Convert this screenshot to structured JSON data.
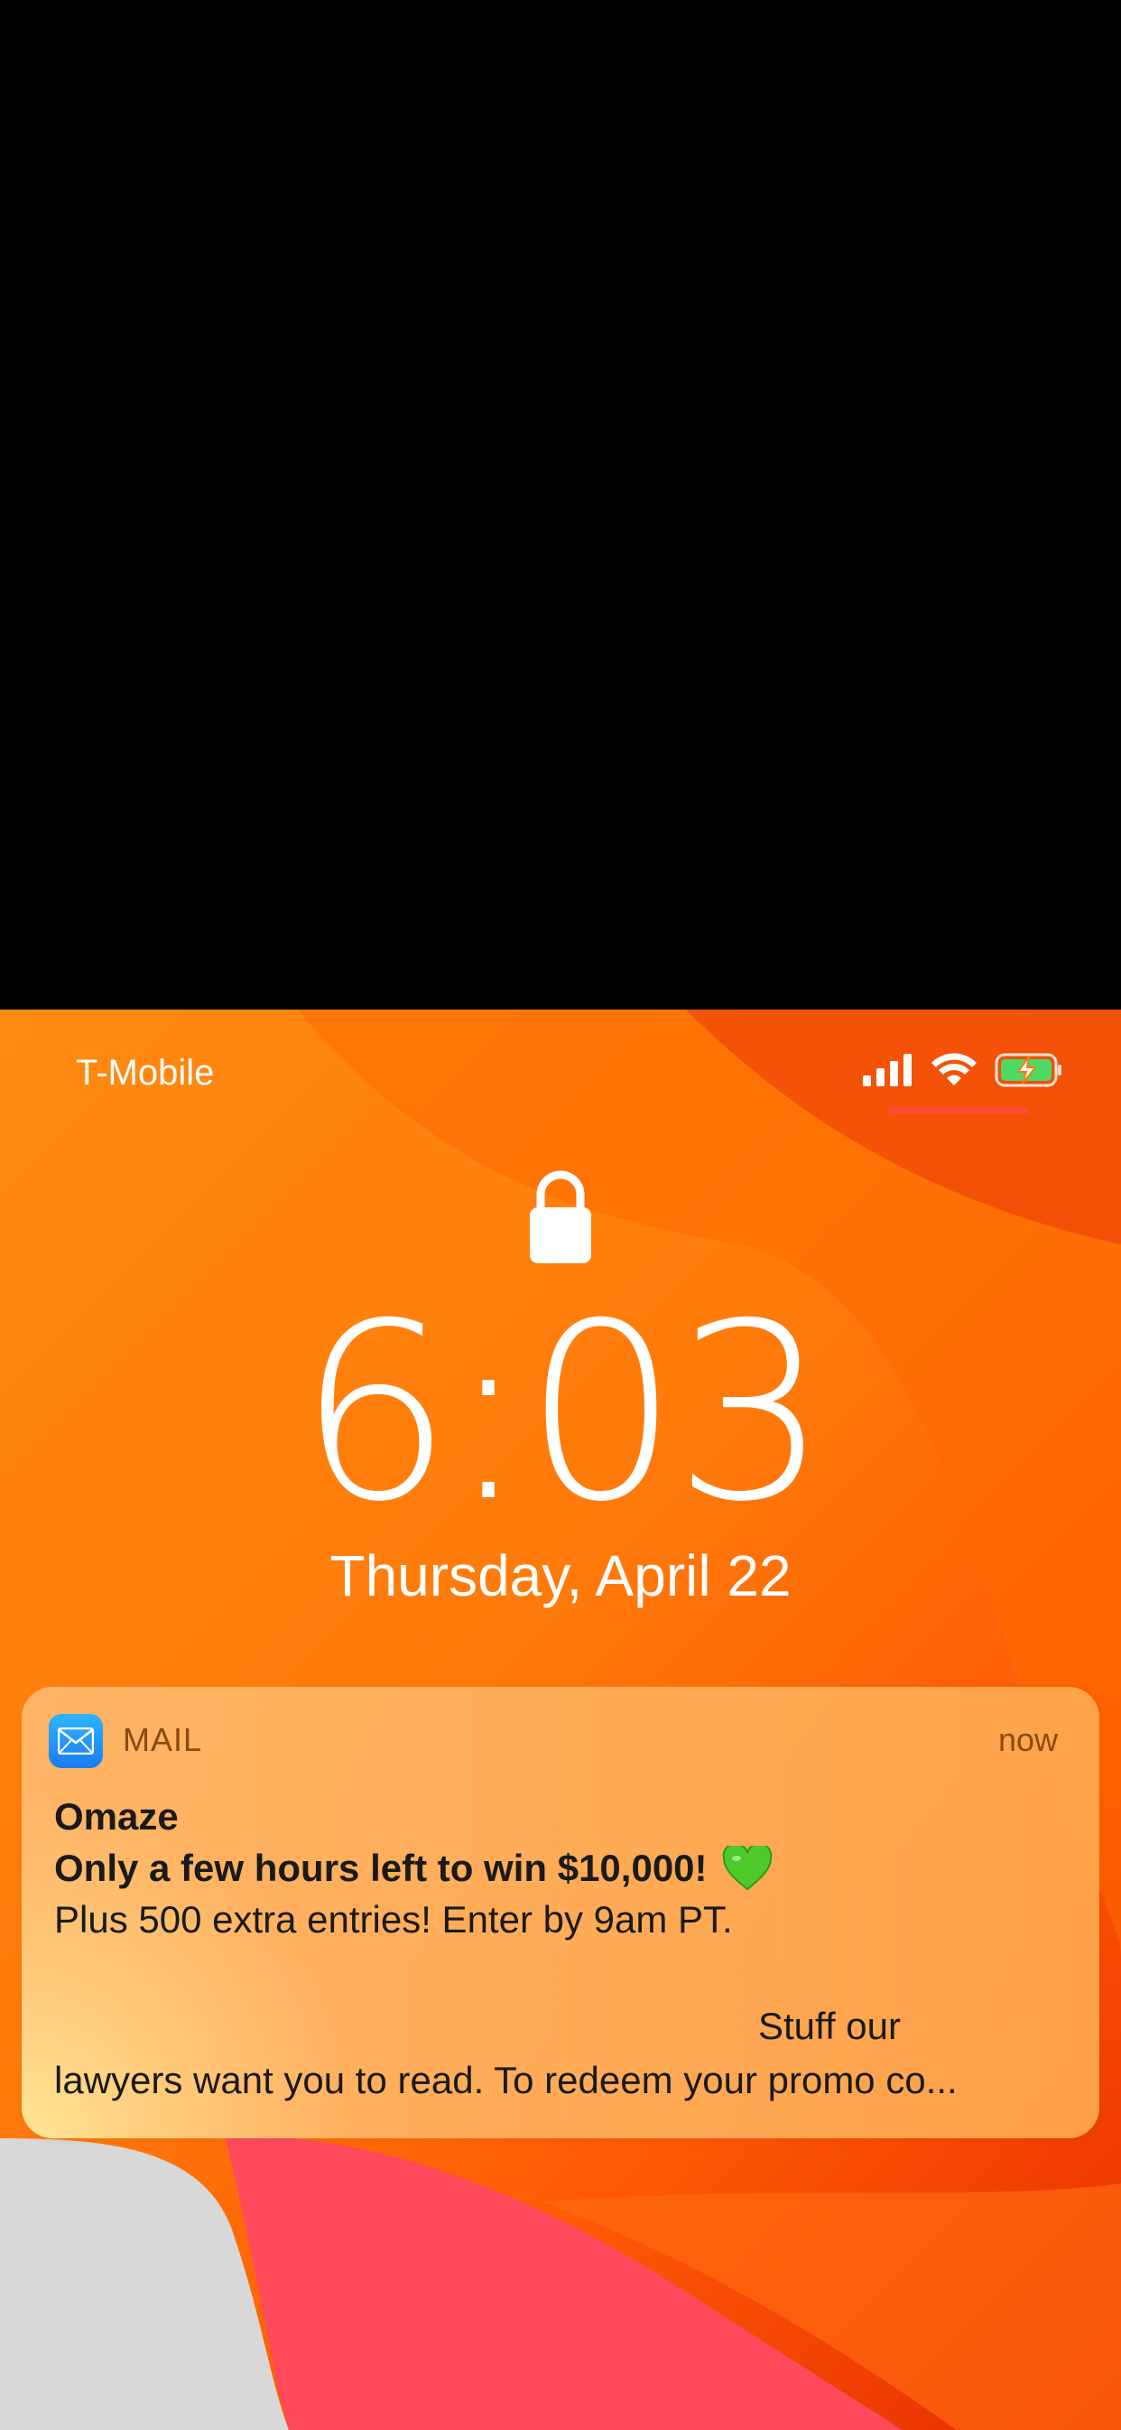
{
  "status_bar": {
    "carrier": "T-Mobile",
    "icons": [
      "cellular-signal-icon",
      "wifi-icon",
      "battery-charging-icon"
    ],
    "battery_color": "#4cd964"
  },
  "lockscreen": {
    "lock_icon": "lock-icon",
    "time": "6:03",
    "date": "Thursday, April 22"
  },
  "notification": {
    "app_icon": "mail-app-icon",
    "app_name": "MAIL",
    "timestamp": "now",
    "sender": "Omaze",
    "subject": "Only a few hours left to win $10,000!",
    "subject_emoji": "green-heart-icon",
    "preview_line1": "Plus 500 extra entries! Enter by 9am PT.",
    "preview_line2": "Stuff our",
    "preview_line3": "lawyers want you to read. To redeem your promo co..."
  },
  "colors": {
    "wallpaper_orange": "#ff7a0a",
    "wallpaper_red": "#e62b00",
    "notification_text": "#1a1a1a",
    "notification_meta": "#8a4a10"
  }
}
